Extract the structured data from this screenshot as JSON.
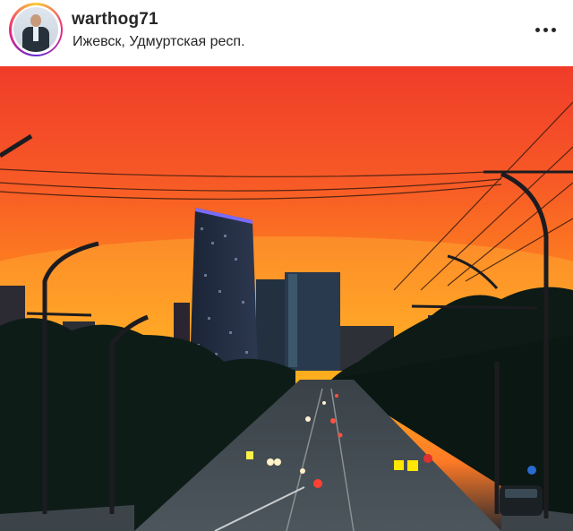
{
  "post": {
    "username": "warthog71",
    "location": "Ижевск, Удмуртская респ.",
    "more_icon": "more-horizontal-icon",
    "avatar_icon": "profile-avatar"
  },
  "photo": {
    "subject": "city-sunset-street",
    "colors": {
      "sky_top": "#f24a2c",
      "sky_mid": "#ff8c1e",
      "sky_low": "#ffb41f",
      "foliage": "#0d1c16",
      "road": "#2a3338",
      "building_glow": "#6d5cff"
    }
  }
}
